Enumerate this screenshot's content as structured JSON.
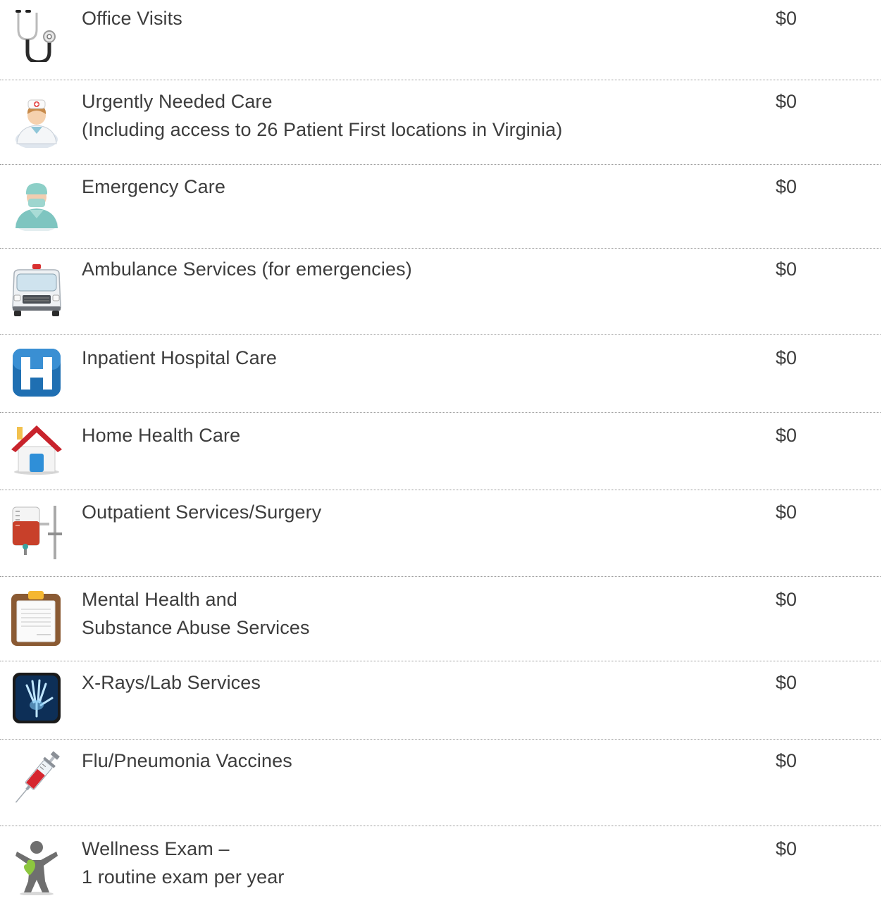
{
  "benefits": [
    {
      "icon": "stethoscope-icon",
      "label": [
        "Office Visits"
      ],
      "cost": "$0"
    },
    {
      "icon": "nurse-icon",
      "label": [
        "Urgently Needed Care",
        "(Including access to 26 Patient First locations in Virginia)"
      ],
      "cost": "$0"
    },
    {
      "icon": "surgeon-icon",
      "label": [
        "Emergency Care"
      ],
      "cost": "$0"
    },
    {
      "icon": "ambulance-icon",
      "label": [
        "Ambulance Services (for emergencies)"
      ],
      "cost": "$0"
    },
    {
      "icon": "hospital-icon",
      "label": [
        "Inpatient Hospital Care"
      ],
      "cost": "$0"
    },
    {
      "icon": "house-icon",
      "label": [
        "Home Health Care"
      ],
      "cost": "$0"
    },
    {
      "icon": "iv-drip-icon",
      "label": [
        "Outpatient Services/Surgery"
      ],
      "cost": "$0"
    },
    {
      "icon": "clipboard-icon",
      "label": [
        "Mental Health and",
        "Substance Abuse Services"
      ],
      "cost": "$0"
    },
    {
      "icon": "xray-hand-icon",
      "label": [
        "X-Rays/Lab Services"
      ],
      "cost": "$0"
    },
    {
      "icon": "syringe-icon",
      "label": [
        "Flu/Pneumonia Vaccines"
      ],
      "cost": "$0"
    },
    {
      "icon": "wellness-person-icon",
      "label": [
        "Wellness Exam –",
        "1 routine exam per year"
      ],
      "cost": "$0"
    }
  ]
}
